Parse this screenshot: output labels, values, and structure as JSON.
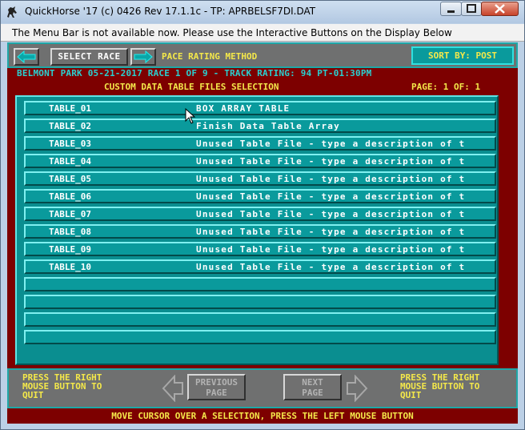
{
  "window": {
    "title": "QuickHorse '17 (c) 0426 Rev 17.1.1c - TP: APRBELSF7DI.DAT",
    "menu_notice": "The Menu Bar is not available now.  Please use the Interactive Buttons on the Display Below"
  },
  "toolbar": {
    "select_race_label": "SELECT RACE",
    "method_label": "PACE RATING METHOD",
    "sort_label": "SORT BY: POST"
  },
  "race_info": "BELMONT PARK 05-21-2017 RACE 1 OF 9 - TRACK RATING: 94 PT-01:30PM",
  "table_panel": {
    "title": "CUSTOM DATA TABLE FILES SELECTION",
    "page_label": "PAGE:",
    "page_current": "1",
    "of_label": "OF:",
    "page_total": "1",
    "rows": [
      {
        "name": "TABLE_01",
        "desc": "BOX ARRAY TABLE"
      },
      {
        "name": "TABLE_02",
        "desc": "Finish Data Table Array"
      },
      {
        "name": "TABLE_03",
        "desc": "Unused Table File - type a description of t"
      },
      {
        "name": "TABLE_04",
        "desc": "Unused Table File - type a description of t"
      },
      {
        "name": "TABLE_05",
        "desc": "Unused Table File - type a description of t"
      },
      {
        "name": "TABLE_06",
        "desc": "Unused Table File - type a description of t"
      },
      {
        "name": "TABLE_07",
        "desc": "Unused Table File - type a description of t"
      },
      {
        "name": "TABLE_08",
        "desc": "Unused Table File - type a description of t"
      },
      {
        "name": "TABLE_09",
        "desc": "Unused Table File - type a description of t"
      },
      {
        "name": "TABLE_10",
        "desc": "Unused Table File - type a description of t"
      },
      {
        "name": "",
        "desc": ""
      },
      {
        "name": "",
        "desc": ""
      },
      {
        "name": "",
        "desc": ""
      },
      {
        "name": "",
        "desc": ""
      }
    ]
  },
  "bottom": {
    "left_hint": "PRESS THE RIGHT\nMOUSE BUTTON TO\nQUIT",
    "right_hint": "PRESS THE RIGHT\nMOUSE BUTTON TO\nQUIT",
    "previous_page_label": "PREVIOUS\nPAGE",
    "next_page_label": "NEXT\nPAGE"
  },
  "status_line": "MOVE CURSOR OVER A SELECTION, PRESS THE LEFT MOUSE BUTTON",
  "colors": {
    "background_maroon": "#7d0000",
    "row_teal": "#0a9a9c",
    "accent_yellow": "#f4e84a",
    "info_cyan": "#2ad0d0"
  }
}
